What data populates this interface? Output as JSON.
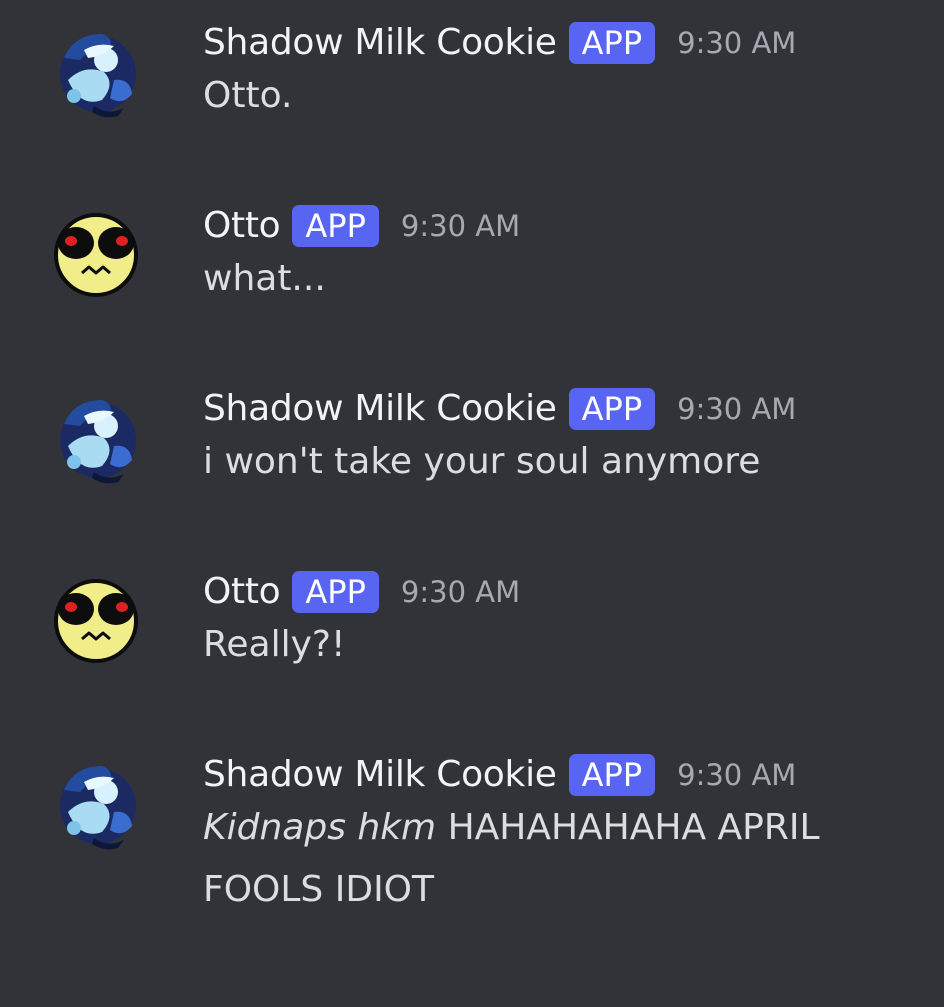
{
  "messages": [
    {
      "author": "Shadow Milk Cookie",
      "badge": "APP",
      "time": "9:30 AM",
      "text": "Otto.",
      "avatar_icon": "shadow-milk-cookie-avatar"
    },
    {
      "author": "Otto",
      "badge": "APP",
      "time": "9:30 AM",
      "text": "what...",
      "avatar_icon": "yellow-smiley-avatar"
    },
    {
      "author": "Shadow Milk Cookie",
      "badge": "APP",
      "time": "9:30 AM",
      "text": "i won't take your soul anymore",
      "avatar_icon": "shadow-milk-cookie-avatar"
    },
    {
      "author": "Otto",
      "badge": "APP",
      "time": "9:30 AM",
      "text": "Really?!",
      "avatar_icon": "yellow-smiley-avatar"
    },
    {
      "author": "Shadow Milk Cookie",
      "badge": "APP",
      "time": "9:30 AM",
      "text_italic": "Kidnaps hkm",
      "text": "HAHAHAHAHA APRIL FOOLS IDIOT",
      "avatar_icon": "shadow-milk-cookie-avatar"
    }
  ],
  "colors": {
    "background": "#313338",
    "username": "#f2f3f5",
    "badge": "#5865f2",
    "timestamp": "#a7a9b0",
    "message_text": "#dbdee1"
  }
}
